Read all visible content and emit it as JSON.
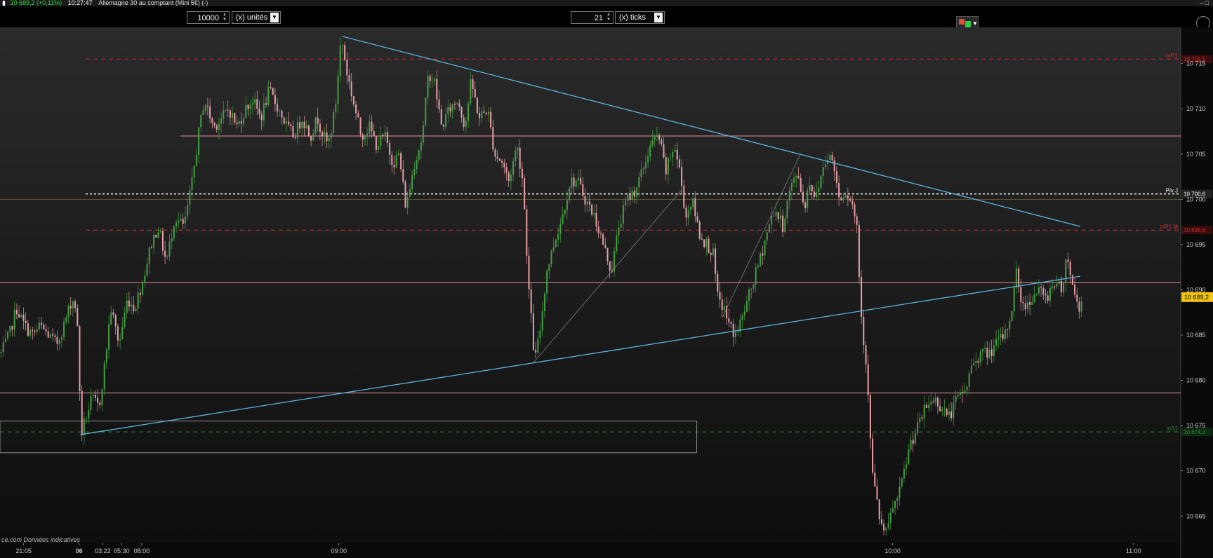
{
  "header": {
    "price": "10 689,2 (+0,11%)",
    "time": "10:27:47",
    "instrument": "Allemagne 30 au comptant (Mini 5€) (-)",
    "window_controls": "– □"
  },
  "toolbar": {
    "quantity_value": "10000",
    "quantity_unit": "(x) unités",
    "ticks_value": "21",
    "ticks_unit": "(x) ticks"
  },
  "colors": {
    "background": "#0c0c0c",
    "up_candle": "#46a045",
    "down_candle": "#e8a0a8",
    "trendline": "#5ab4e0",
    "resistance_line": "#e98ea0",
    "red_level": "#d03030",
    "green_level": "#2e8b3e",
    "pivot": "#ffffff",
    "current_price_tag": "#f1c40f"
  },
  "chart_data": {
    "type": "candlestick",
    "instrument": "Allemagne 30 au comptant (Mini 5€)",
    "ylim": [
      10662,
      10719
    ],
    "y_ticks": [
      10665,
      10670,
      10675,
      10680,
      10685,
      10690,
      10695,
      10700,
      10705,
      10710,
      10715
    ],
    "y_tick_labels": [
      "10 665",
      "10 670",
      "10 675",
      "10 680",
      "10 685",
      "10 690",
      "10 695",
      "10 700",
      "10 705",
      "10 710",
      "10 715"
    ],
    "x_tick_labels": [
      "21:05",
      "06",
      "03:22",
      "05:30",
      "08:00",
      "09:00",
      "10:00",
      "11:00"
    ],
    "x_tick_positions": [
      0.02,
      0.067,
      0.087,
      0.103,
      0.12,
      0.287,
      0.756,
      0.96
    ],
    "path": [
      [
        0,
        10683
      ],
      [
        0.007,
        10685
      ],
      [
        0.013,
        10688
      ],
      [
        0.02,
        10686
      ],
      [
        0.027,
        10685
      ],
      [
        0.033,
        10686
      ],
      [
        0.04,
        10685
      ],
      [
        0.047,
        10684
      ],
      [
        0.053,
        10686
      ],
      [
        0.06,
        10689
      ],
      [
        0.064,
        10688
      ],
      [
        0.068,
        10674
      ],
      [
        0.072,
        10676
      ],
      [
        0.077,
        10678
      ],
      [
        0.083,
        10677
      ],
      [
        0.088,
        10682
      ],
      [
        0.093,
        10688
      ],
      [
        0.1,
        10684
      ],
      [
        0.107,
        10689
      ],
      [
        0.113,
        10688
      ],
      [
        0.12,
        10691
      ],
      [
        0.127,
        10695
      ],
      [
        0.133,
        10697
      ],
      [
        0.14,
        10693
      ],
      [
        0.147,
        10698
      ],
      [
        0.155,
        10697
      ],
      [
        0.162,
        10702
      ],
      [
        0.167,
        10707
      ],
      [
        0.172,
        10711
      ],
      [
        0.18,
        10708
      ],
      [
        0.187,
        10709
      ],
      [
        0.193,
        10710
      ],
      [
        0.2,
        10708
      ],
      [
        0.207,
        10710
      ],
      [
        0.213,
        10711
      ],
      [
        0.22,
        10709
      ],
      [
        0.227,
        10712
      ],
      [
        0.235,
        10710
      ],
      [
        0.242,
        10708
      ],
      [
        0.248,
        10707
      ],
      [
        0.255,
        10709
      ],
      [
        0.262,
        10707
      ],
      [
        0.268,
        10709
      ],
      [
        0.273,
        10707
      ],
      [
        0.277,
        10706
      ],
      [
        0.283,
        10710
      ],
      [
        0.288,
        10718
      ],
      [
        0.293,
        10714
      ],
      [
        0.298,
        10711
      ],
      [
        0.305,
        10707
      ],
      [
        0.312,
        10708
      ],
      [
        0.318,
        10706
      ],
      [
        0.325,
        10707
      ],
      [
        0.332,
        10704
      ],
      [
        0.337,
        10705
      ],
      [
        0.343,
        10699
      ],
      [
        0.35,
        10704
      ],
      [
        0.357,
        10707
      ],
      [
        0.362,
        10714
      ],
      [
        0.367,
        10713
      ],
      [
        0.373,
        10708
      ],
      [
        0.38,
        10710
      ],
      [
        0.387,
        10711
      ],
      [
        0.393,
        10708
      ],
      [
        0.398,
        10713
      ],
      [
        0.405,
        10709
      ],
      [
        0.412,
        10710
      ],
      [
        0.418,
        10705
      ],
      [
        0.425,
        10704
      ],
      [
        0.43,
        10702
      ],
      [
        0.437,
        10706
      ],
      [
        0.442,
        10702
      ],
      [
        0.447,
        10690
      ],
      [
        0.452,
        10682
      ],
      [
        0.457,
        10686
      ],
      [
        0.462,
        10692
      ],
      [
        0.468,
        10695
      ],
      [
        0.475,
        10698
      ],
      [
        0.482,
        10702
      ],
      [
        0.488,
        10702
      ],
      [
        0.495,
        10700
      ],
      [
        0.503,
        10698
      ],
      [
        0.51,
        10695
      ],
      [
        0.517,
        10692
      ],
      [
        0.523,
        10697
      ],
      [
        0.53,
        10700
      ],
      [
        0.537,
        10701
      ],
      [
        0.543,
        10703
      ],
      [
        0.55,
        10706
      ],
      [
        0.557,
        10707
      ],
      [
        0.563,
        10703
      ],
      [
        0.57,
        10706
      ],
      [
        0.575,
        10703
      ],
      [
        0.58,
        10698
      ],
      [
        0.585,
        10700
      ],
      [
        0.592,
        10696
      ],
      [
        0.598,
        10695
      ],
      [
        0.603,
        10694
      ],
      [
        0.607,
        10689
      ],
      [
        0.612,
        10688
      ],
      [
        0.617,
        10686
      ],
      [
        0.622,
        10685
      ],
      [
        0.628,
        10687
      ],
      [
        0.635,
        10690
      ],
      [
        0.642,
        10693
      ],
      [
        0.648,
        10696
      ],
      [
        0.655,
        10699
      ],
      [
        0.662,
        10697
      ],
      [
        0.668,
        10701
      ],
      [
        0.675,
        10703
      ],
      [
        0.68,
        10699
      ],
      [
        0.685,
        10702
      ],
      [
        0.69,
        10700
      ],
      [
        0.695,
        10703
      ],
      [
        0.7,
        10705
      ],
      [
        0.705,
        10704
      ],
      [
        0.71,
        10700
      ],
      [
        0.715,
        10701
      ],
      [
        0.72,
        10700
      ],
      [
        0.725,
        10697
      ],
      [
        0.728,
        10688
      ],
      [
        0.731,
        10684
      ],
      [
        0.734,
        10680
      ],
      [
        0.737,
        10671
      ],
      [
        0.74,
        10668
      ],
      [
        0.745,
        10664
      ],
      [
        0.75,
        10663
      ],
      [
        0.755,
        10666
      ],
      [
        0.76,
        10667
      ],
      [
        0.765,
        10670
      ],
      [
        0.77,
        10673
      ],
      [
        0.777,
        10675
      ],
      [
        0.783,
        10677
      ],
      [
        0.79,
        10678
      ],
      [
        0.797,
        10677
      ],
      [
        0.803,
        10676
      ],
      [
        0.81,
        10678
      ],
      [
        0.817,
        10679
      ],
      [
        0.823,
        10682
      ],
      [
        0.83,
        10683
      ],
      [
        0.837,
        10683
      ],
      [
        0.843,
        10684
      ],
      [
        0.85,
        10685
      ],
      [
        0.855,
        10687
      ],
      [
        0.86,
        10692
      ],
      [
        0.865,
        10688
      ],
      [
        0.872,
        10689
      ],
      [
        0.878,
        10690
      ],
      [
        0.885,
        10689
      ],
      [
        0.892,
        10691
      ],
      [
        0.898,
        10690
      ],
      [
        0.903,
        10694
      ],
      [
        0.908,
        10690
      ],
      [
        0.913,
        10688
      ],
      [
        0.917,
        10689.2
      ]
    ],
    "horizontal_levels": [
      {
        "name": "mR1",
        "value": 10715.5,
        "style": "red-dashed",
        "tag": "10 715,5"
      },
      {
        "name": "",
        "value": 10707,
        "style": "pink-solid"
      },
      {
        "name": "Piv J",
        "value": 10700.6,
        "style": "white-dotted",
        "tag": "10 700,6"
      },
      {
        "name": "",
        "value": 10700,
        "style": "orange-thin"
      },
      {
        "name": "mR1 M",
        "value": 10696.6,
        "style": "red-dashed",
        "tag": "10 696,6"
      },
      {
        "name": "",
        "value": 10690.8,
        "style": "pink-solid"
      },
      {
        "name": "",
        "value": 10678.6,
        "style": "pink-solid"
      },
      {
        "name": "mS1",
        "value": 10674.3,
        "style": "green-dashed",
        "tag": "10 674,3"
      }
    ],
    "current_price": 10689.2,
    "current_price_label": "10 689,2",
    "trendlines": [
      {
        "from": [
          0.29,
          10718
        ],
        "to": [
          0.915,
          10697
        ],
        "color": "trendline"
      },
      {
        "from": [
          0.068,
          10674
        ],
        "to": [
          0.915,
          10691.5
        ],
        "color": "trendline"
      },
      {
        "from": [
          0.452,
          10682
        ],
        "to": [
          0.577,
          10701
        ],
        "color": "thin-gray"
      },
      {
        "from": [
          0.612,
          10687
        ],
        "to": [
          0.678,
          10705
        ],
        "color": "thin-gray"
      }
    ],
    "zone_rect": {
      "x0": 0,
      "x1": 0.59,
      "y_top": 10675.5,
      "y_bottom": 10672
    },
    "watermark": "ce.com  Données indicatives"
  }
}
